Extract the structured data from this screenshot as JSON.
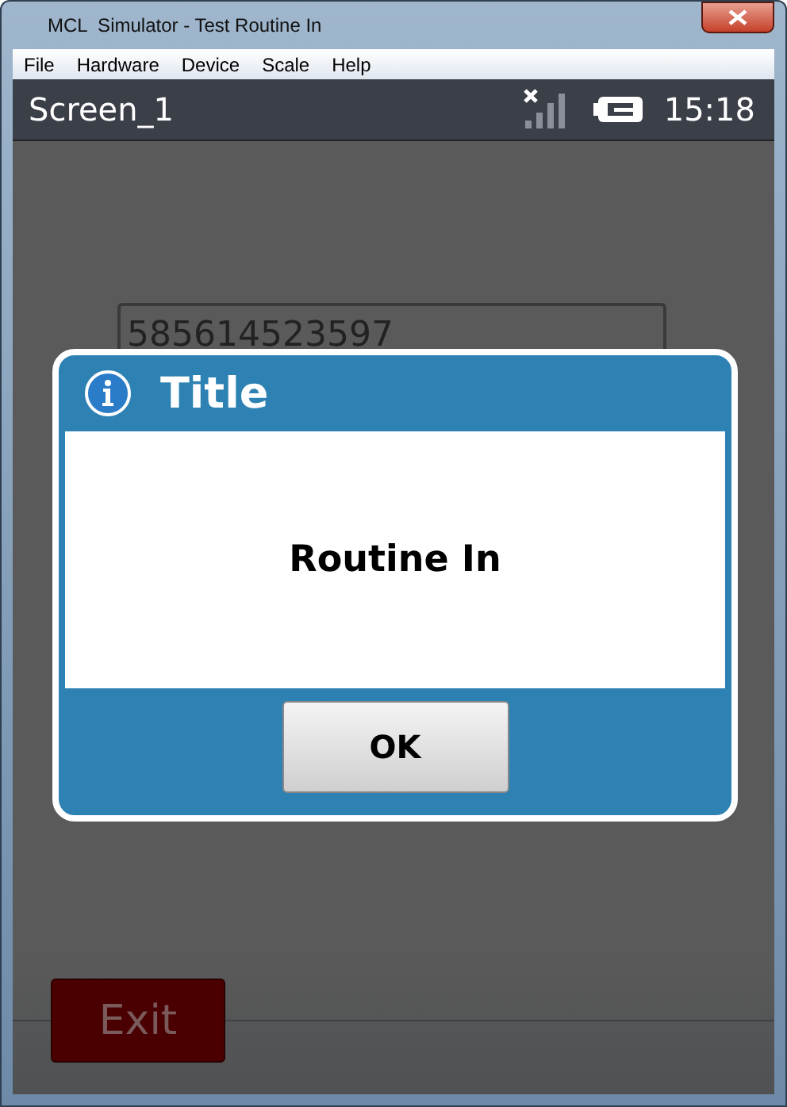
{
  "window": {
    "title": "MCL  Simulator - Test Routine In"
  },
  "menu": [
    "File",
    "Hardware",
    "Device",
    "Scale",
    "Help"
  ],
  "status_bar": {
    "screen": "Screen_1",
    "time": "15:18"
  },
  "field": {
    "value": "585614523597"
  },
  "dialog": {
    "title": "Title",
    "message": "Routine In",
    "button": "OK"
  },
  "exit_button": {
    "label": "Exit",
    "disabled": true
  }
}
